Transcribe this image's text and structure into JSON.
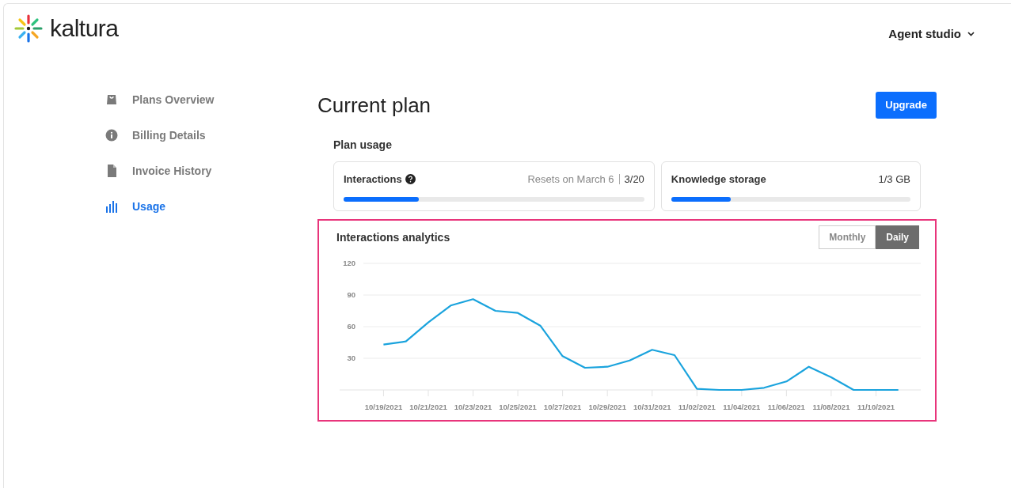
{
  "header": {
    "logo_text": "kaltura",
    "account_menu": "Agent studio"
  },
  "sidebar": {
    "items": [
      {
        "label": "Plans Overview",
        "kind": "bag",
        "selected": false
      },
      {
        "label": "Billing Details",
        "kind": "info",
        "selected": false
      },
      {
        "label": "Invoice History",
        "kind": "file",
        "selected": false
      },
      {
        "label": "Usage",
        "kind": "bars",
        "selected": true
      }
    ]
  },
  "page_title": "Current plan",
  "upgrade_button": "Upgrade",
  "plan_usage": {
    "title": "Plan usage",
    "meters": [
      {
        "label": "Interactions",
        "help": true,
        "note": "Resets on March 6",
        "reading": "3/20",
        "level": 0.25
      },
      {
        "label": "Knowledge storage",
        "help": false,
        "reading": "1/3 GB",
        "level": 0.25
      }
    ]
  },
  "analytics": {
    "title": "Interactions analytics",
    "highlighted": true,
    "toggle": [
      {
        "label": "Monthly",
        "selected": false
      },
      {
        "label": "Daily",
        "selected": true
      }
    ],
    "chart_data": {
      "type": "line",
      "categories": [
        "10/19/2021",
        null,
        "10/21/2021",
        null,
        "10/23/2021",
        null,
        "10/25/2021",
        null,
        "10/27/2021",
        null,
        "10/29/2021",
        null,
        "10/31/2021",
        null,
        "11/02/2021",
        null,
        "11/04/2021",
        null,
        "11/06/2021",
        null,
        "11/08/2021",
        null,
        "11/10/2021",
        null
      ],
      "series": [
        {
          "color": "#1aa3dd",
          "values": [
            43,
            46,
            64,
            80,
            86,
            75,
            73,
            61,
            32,
            21,
            22,
            28,
            38,
            33,
            1,
            0,
            0,
            2,
            8,
            22,
            12,
            0,
            0,
            0
          ]
        }
      ],
      "ylim": [
        0,
        120
      ],
      "grid": true,
      "yticks": [
        30,
        60,
        90,
        120
      ]
    }
  }
}
